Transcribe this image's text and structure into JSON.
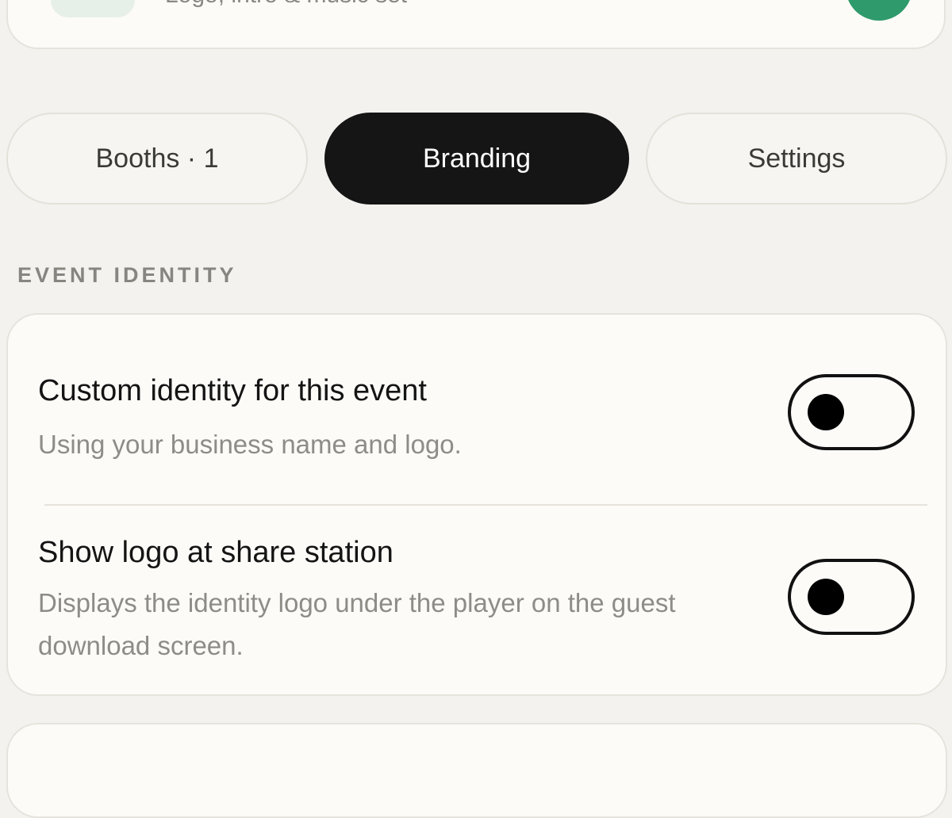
{
  "top_card": {
    "subtitle": "Logo, intro & music set",
    "thumb_icon": "media-thumbnail",
    "status_icon": "status-dot-icon",
    "status_color": "#2f9a6b"
  },
  "tabs": [
    {
      "label": "Booths · 1",
      "active": false
    },
    {
      "label": "Branding",
      "active": true
    },
    {
      "label": "Settings",
      "active": false
    }
  ],
  "section": {
    "label": "EVENT IDENTITY"
  },
  "settings": [
    {
      "title": "Custom identity for this event",
      "description": "Using your business name and logo.",
      "enabled": false
    },
    {
      "title": "Show logo at share station",
      "description": "Displays the identity logo under the player on the guest download screen.",
      "enabled": false
    }
  ],
  "colors": {
    "active_tab": "#151515",
    "background": "#f3f2ee",
    "card": "#fcfbf8",
    "muted_text": "#8e8c87"
  }
}
